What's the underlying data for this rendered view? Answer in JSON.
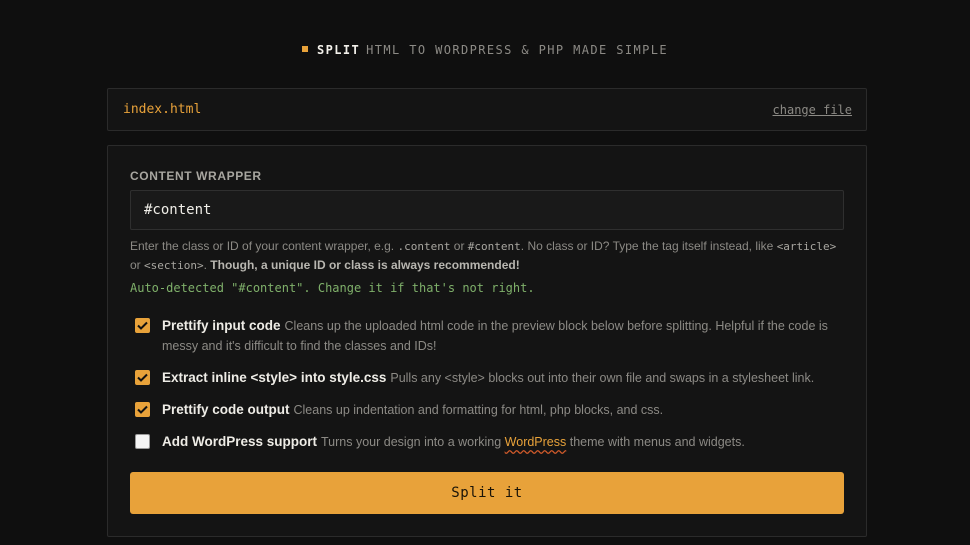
{
  "header": {
    "brand": "SPLIT",
    "tagline": "HTML TO WORDPRESS & PHP MADE SIMPLE"
  },
  "file": {
    "name": "index.html",
    "change_label": "change file"
  },
  "content_wrapper": {
    "label": "CONTENT WRAPPER",
    "value": "#content",
    "help": {
      "t1": "Enter the class or ID of your content wrapper, e.g. ",
      "c1": ".content",
      "t2": " or ",
      "c2": "#content",
      "t3": ". No class or ID? Type the tag itself instead, like ",
      "c3": "<article>",
      "t4": " or ",
      "c4": "<section>",
      "t5": ". ",
      "bold": "Though, a unique ID or class is always recommended!"
    },
    "autodetect": "Auto-detected \"#content\". Change it if that's not right."
  },
  "options": [
    {
      "title": "Prettify input code",
      "desc": "Cleans up the uploaded html code in the preview block below before splitting. Helpful if the code is messy and it's difficult to find the classes and IDs!",
      "checked": true
    },
    {
      "title": "Extract inline <style> into style.css",
      "desc": "Pulls any <style> blocks out into their own file and swaps in a stylesheet link.",
      "checked": true
    },
    {
      "title": "Prettify code output",
      "desc": "Cleans up indentation and formatting for html, php blocks, and css.",
      "checked": true
    },
    {
      "title": "Add WordPress support",
      "desc_before": "Turns your design into a working ",
      "link": "WordPress",
      "desc_after": " theme with menus and widgets.",
      "checked": false
    }
  ],
  "action": {
    "label": "Split it"
  },
  "colors": {
    "accent": "#e8a23a",
    "background": "#0f0f0f",
    "success": "#7fb06a"
  }
}
